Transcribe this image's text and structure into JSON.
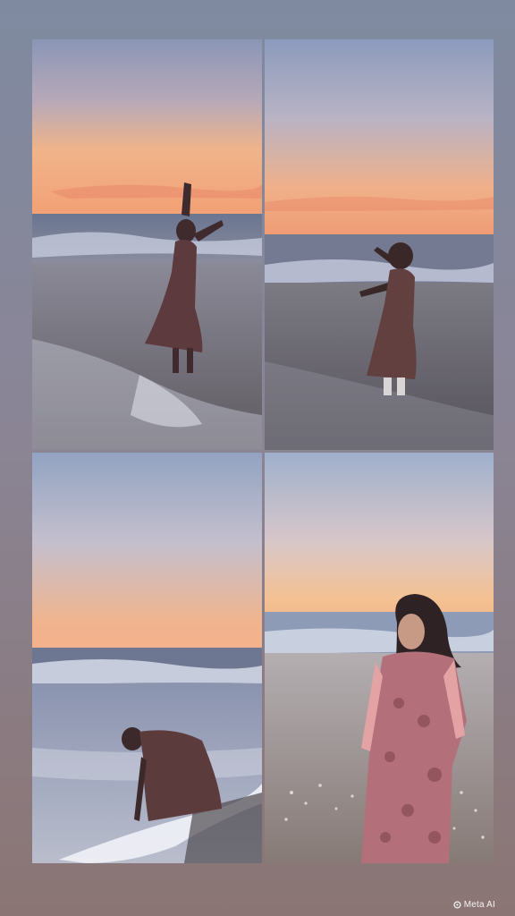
{
  "watermark": {
    "label": "Meta AI",
    "icon": "meta-ai-icon"
  },
  "collage": {
    "layout": "2x2 grid",
    "panels": [
      {
        "position": "top-left",
        "scene": "figure-arms-raised-at-sunset"
      },
      {
        "position": "top-right",
        "scene": "figure-dancing-in-surf"
      },
      {
        "position": "bottom-left",
        "scene": "figure-bending-to-touch-wave"
      },
      {
        "position": "bottom-right",
        "scene": "figure-portrait-on-shore"
      }
    ]
  },
  "colors": {
    "frame_top": "#7f8aa0",
    "frame_bottom": "#8b7574",
    "sky_top": "#8d9bbb",
    "sunset_glow": "#f2a777",
    "sand": "#75706e",
    "dress": "#7a4747"
  }
}
